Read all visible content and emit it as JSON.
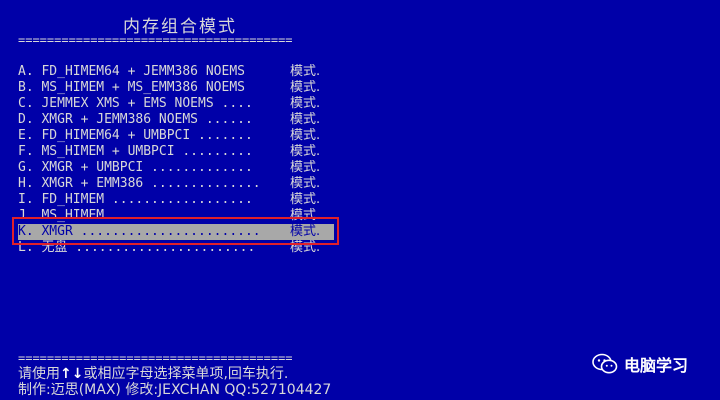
{
  "title": "内存组合模式",
  "rule": "======================================",
  "menu": {
    "items": [
      {
        "key": "A",
        "label": "A. FD_HIMEM64 + JEMM386 NOEMS ",
        "mode": "模式."
      },
      {
        "key": "B",
        "label": "B. MS_HIMEM + MS_EMM386 NOEMS ",
        "mode": "模式."
      },
      {
        "key": "C",
        "label": "C. JEMMEX XMS + EMS NOEMS ....",
        "mode": "模式."
      },
      {
        "key": "D",
        "label": "D. XMGR + JEMM386 NOEMS ......",
        "mode": "模式."
      },
      {
        "key": "E",
        "label": "E. FD_HIMEM64 + UMBPCI .......",
        "mode": "模式."
      },
      {
        "key": "F",
        "label": "F. MS_HIMEM + UMBPCI .........",
        "mode": "模式."
      },
      {
        "key": "G",
        "label": "G. XMGR + UMBPCI .............",
        "mode": "模式."
      },
      {
        "key": "H",
        "label": "H. XMGR + EMM386 ..............",
        "mode": "模式."
      },
      {
        "key": "I",
        "label": "I. FD_HIMEM ..................",
        "mode": "模式."
      },
      {
        "key": "J",
        "label": "J. MS_HIMEM ..................",
        "mode": "模式."
      },
      {
        "key": "K",
        "label": "K. XMGR .......................",
        "mode": "模式."
      },
      {
        "key": "L",
        "label": "L. 无盘 .......................",
        "mode": "模式."
      }
    ],
    "selected_key": "K"
  },
  "help": {
    "prefix": "请使用",
    "arrow_up": "↑",
    "arrow_down": "↓",
    "suffix": "或相应字母选择菜单项,回车执行."
  },
  "credits": "制作:迈思(MAX) 修改:JEXCHAN QQ:527104427",
  "watermark": {
    "text": "电脑学习",
    "icon": "wechat-icon"
  },
  "colors": {
    "background": "#0000a8",
    "text": "#d8d8d8",
    "highlight": "#a8a8a8",
    "selection_border": "#e0202a"
  }
}
